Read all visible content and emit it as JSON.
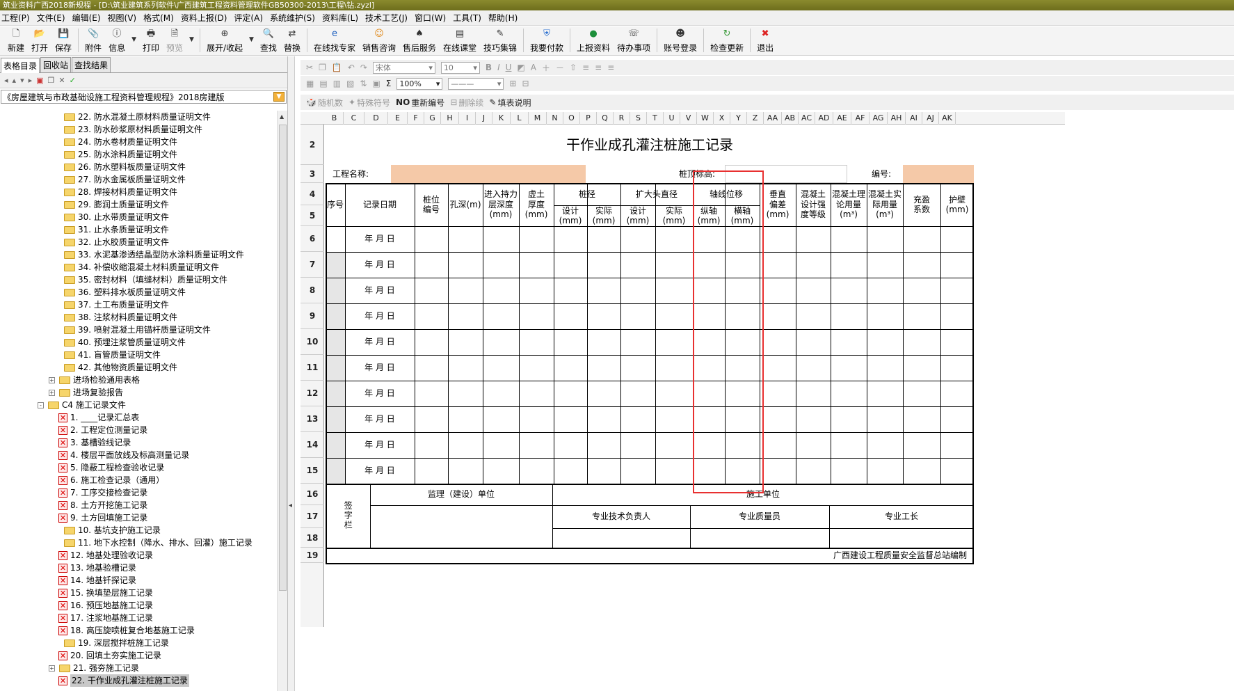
{
  "window": {
    "title": "筑业资料广西2018新规程 - [D:\\筑业建筑系列软件\\广西建筑工程资料管理软件GB50300-2013\\工程\\钻.zyzl]"
  },
  "menu": [
    "工程(P)",
    "文件(E)",
    "编辑(E)",
    "视图(V)",
    "格式(M)",
    "资料上报(D)",
    "评定(A)",
    "系统维护(S)",
    "资料库(L)",
    "技术工艺(J)",
    "窗口(W)",
    "工具(T)",
    "帮助(H)"
  ],
  "toolbar": [
    {
      "label": "新建",
      "icon": "new-file-icon"
    },
    {
      "label": "打开",
      "icon": "open-folder-icon"
    },
    {
      "label": "保存",
      "icon": "save-icon"
    },
    {
      "label": "附件",
      "icon": "attachment-icon"
    },
    {
      "label": "信息",
      "icon": "info-icon"
    },
    {
      "label": "打印",
      "icon": "print-icon"
    },
    {
      "label": "预览",
      "icon": "preview-icon"
    },
    {
      "label": "展开/收起",
      "icon": "expand-icon"
    },
    {
      "label": "查找",
      "icon": "search-icon"
    },
    {
      "label": "替换",
      "icon": "replace-icon"
    },
    {
      "label": "在线找专家",
      "icon": "expert-icon"
    },
    {
      "label": "销售咨询",
      "icon": "sales-icon"
    },
    {
      "label": "售后服务",
      "icon": "service-icon"
    },
    {
      "label": "在线课堂",
      "icon": "class-icon"
    },
    {
      "label": "技巧集锦",
      "icon": "tips-icon"
    },
    {
      "label": "我要付款",
      "icon": "pay-icon"
    },
    {
      "label": "上报资料",
      "icon": "upload-icon"
    },
    {
      "label": "待办事项",
      "icon": "todo-icon"
    },
    {
      "label": "账号登录",
      "icon": "login-icon"
    },
    {
      "label": "检查更新",
      "icon": "update-icon"
    },
    {
      "label": "退出",
      "icon": "exit-icon"
    }
  ],
  "sidebar": {
    "tabs": [
      "表格目录",
      "回收站",
      "查找结果"
    ],
    "path": "《房屋建筑与市政基础设施工程资料管理规程》2018房建版",
    "items": [
      {
        "label": "22. 防水混凝土原材料质量证明文件",
        "type": "folder",
        "indent": 1
      },
      {
        "label": "23. 防水砂浆原材料质量证明文件",
        "type": "folder",
        "indent": 1
      },
      {
        "label": "24. 防水卷材质量证明文件",
        "type": "folder",
        "indent": 1
      },
      {
        "label": "25. 防水涂料质量证明文件",
        "type": "folder",
        "indent": 1
      },
      {
        "label": "26. 防水塑料板质量证明文件",
        "type": "folder",
        "indent": 1
      },
      {
        "label": "27. 防水金属板质量证明文件",
        "type": "folder",
        "indent": 1
      },
      {
        "label": "28. 焊接材料质量证明文件",
        "type": "folder",
        "indent": 1
      },
      {
        "label": "29. 膨润土质量证明文件",
        "type": "folder",
        "indent": 1
      },
      {
        "label": "30. 止水带质量证明文件",
        "type": "folder",
        "indent": 1
      },
      {
        "label": "31. 止水条质量证明文件",
        "type": "folder",
        "indent": 1
      },
      {
        "label": "32. 止水胶质量证明文件",
        "type": "folder",
        "indent": 1
      },
      {
        "label": "33. 水泥基渗透结晶型防水涂料质量证明文件",
        "type": "folder",
        "indent": 1
      },
      {
        "label": "34. 补偿收缩混凝土材料质量证明文件",
        "type": "folder",
        "indent": 1
      },
      {
        "label": "35. 密封材料（填缝材料）质量证明文件",
        "type": "folder",
        "indent": 1
      },
      {
        "label": "36. 塑料排水板质量证明文件",
        "type": "folder",
        "indent": 1
      },
      {
        "label": "37. 土工布质量证明文件",
        "type": "folder",
        "indent": 1
      },
      {
        "label": "38. 注浆材料质量证明文件",
        "type": "folder",
        "indent": 1
      },
      {
        "label": "39. 喷射混凝土用锚杆质量证明文件",
        "type": "folder",
        "indent": 1
      },
      {
        "label": "40. 预埋注浆管质量证明文件",
        "type": "folder",
        "indent": 1
      },
      {
        "label": "41. 盲管质量证明文件",
        "type": "folder",
        "indent": 1
      },
      {
        "label": "42. 其他物资质量证明文件",
        "type": "folder",
        "indent": 1
      },
      {
        "label": "进场检验通用表格",
        "type": "group",
        "indent": 0,
        "exp": "+"
      },
      {
        "label": "进场复验报告",
        "type": "group",
        "indent": 0,
        "exp": "+"
      },
      {
        "label": "C4  施工记录文件",
        "type": "group",
        "indent": -1,
        "exp": "-"
      },
      {
        "label": "1. ____记录汇总表",
        "type": "file",
        "indent": 1
      },
      {
        "label": "2. 工程定位测量记录",
        "type": "file",
        "indent": 1
      },
      {
        "label": "3. 基槽验线记录",
        "type": "file",
        "indent": 1
      },
      {
        "label": "4. 楼层平面放线及标高测量记录",
        "type": "file",
        "indent": 1
      },
      {
        "label": "5. 隐蔽工程检查验收记录",
        "type": "file",
        "indent": 1
      },
      {
        "label": "6. 施工检查记录（通用）",
        "type": "file",
        "indent": 1
      },
      {
        "label": "7. 工序交接检查记录",
        "type": "file",
        "indent": 1
      },
      {
        "label": "8. 土方开挖施工记录",
        "type": "file",
        "indent": 1
      },
      {
        "label": "9. 土方回填施工记录",
        "type": "file",
        "indent": 1
      },
      {
        "label": "10. 基坑支护施工记录",
        "type": "folder",
        "indent": 1
      },
      {
        "label": "11. 地下水控制（降水、排水、回灌）施工记录",
        "type": "folder",
        "indent": 1
      },
      {
        "label": "12. 地基处理验收记录",
        "type": "file",
        "indent": 1
      },
      {
        "label": "13. 地基验槽记录",
        "type": "file",
        "indent": 1
      },
      {
        "label": "14. 地基钎探记录",
        "type": "file",
        "indent": 1
      },
      {
        "label": "15. 换填垫层施工记录",
        "type": "file",
        "indent": 1
      },
      {
        "label": "16. 预压地基施工记录",
        "type": "file",
        "indent": 1
      },
      {
        "label": "17. 注浆地基施工记录",
        "type": "file",
        "indent": 1
      },
      {
        "label": "18. 高压旋喷桩复合地基施工记录",
        "type": "file",
        "indent": 1
      },
      {
        "label": "19. 深层搅拌桩施工记录",
        "type": "folder",
        "indent": 1
      },
      {
        "label": "20. 回填土夯实施工记录",
        "type": "file",
        "indent": 1
      },
      {
        "label": "21. 强夯施工记录",
        "type": "folder",
        "indent": 0,
        "exp": "+"
      },
      {
        "label": "22. 干作业成孔灌注桩施工记录",
        "type": "file",
        "indent": 1,
        "selected": true
      }
    ]
  },
  "format_toolbar": {
    "font": "宋体",
    "size": "10",
    "zoom": "100%",
    "sigma": "Σ"
  },
  "action_toolbar": [
    "随机数",
    "特殊符号",
    "重新编号",
    "删除续",
    "填表说明"
  ],
  "columns": [
    "B",
    "C",
    "D",
    "E",
    "F",
    "G",
    "H",
    "I",
    "J",
    "K",
    "L",
    "M",
    "N",
    "O",
    "P",
    "Q",
    "R",
    "S",
    "T",
    "U",
    "V",
    "W",
    "X",
    "Y",
    "Z",
    "AA",
    "AB",
    "AC",
    "AD",
    "AE",
    "AF",
    "AG",
    "AH",
    "AI",
    "AJ",
    "AK"
  ],
  "rows": [
    "2",
    "3",
    "4",
    "5",
    "6",
    "7",
    "8",
    "9",
    "10",
    "11",
    "12",
    "13",
    "14",
    "15",
    "16",
    "17",
    "18",
    "19"
  ],
  "form": {
    "title": "干作业成孔灌注桩施工记录",
    "project_label": "工程名称:",
    "pile_top_label": "桩顶标高:",
    "number_label": "编号:",
    "headers": {
      "seq": "序号",
      "date": "记录日期",
      "pile_no": "桩位编号",
      "depth": "孔深(m)",
      "bearing": "进入持力层深度(mm)",
      "soil": "虚土厚度(mm)",
      "pile_dia": "桩径",
      "design": "设计(mm)",
      "actual": "实际(mm)",
      "enlarge": "扩大头直径",
      "axis_shift": "轴线位移",
      "longi": "纵轴(mm)",
      "trans": "横轴(mm)",
      "vertical": "垂直偏差(mm)",
      "grade": "混凝土设计强度等级",
      "theory": "混凝土理论用量(m³)",
      "real": "混凝土实际用量(m³)",
      "fill": "充盈系数",
      "wall": "护壁(mm)"
    },
    "date_text": "年   月   日",
    "sign_label": "签字栏",
    "supervisor": "监理（建设）单位",
    "contractor": "施工单位",
    "tech_lead": "专业技术负责人",
    "qa": "专业质量员",
    "foreman": "专业工长",
    "footer": "广西建设工程质量安全监督总站编制"
  }
}
